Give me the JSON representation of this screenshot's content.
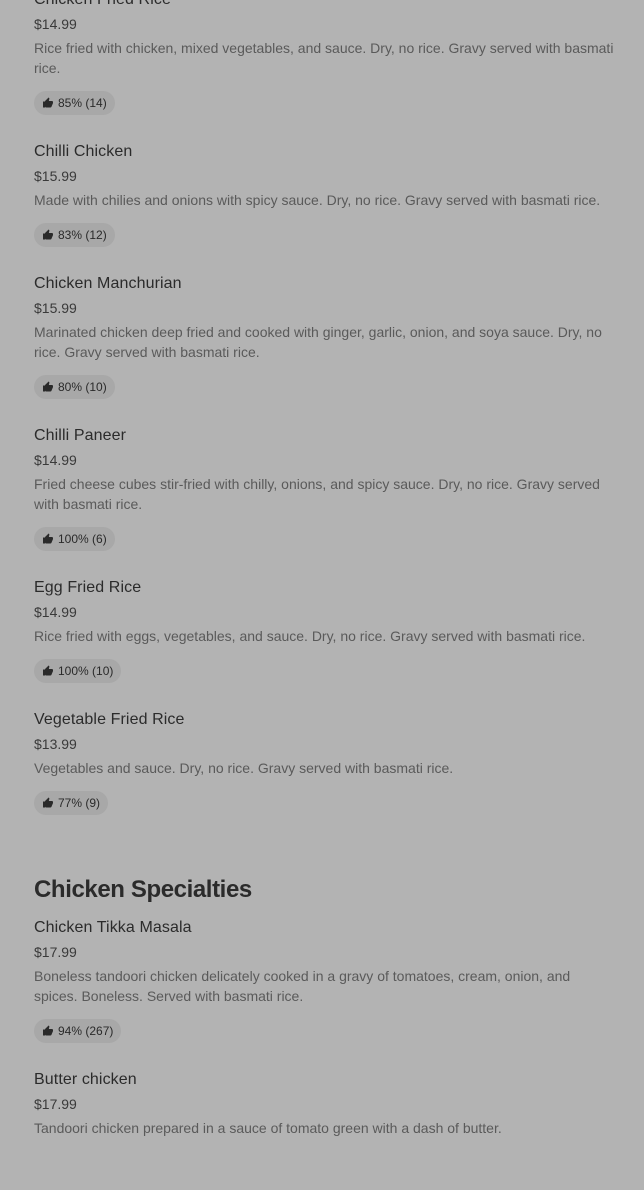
{
  "section1": {
    "items": [
      {
        "name": "Chicken Fried Rice",
        "price": "$14.99",
        "description": "Rice fried with chicken, mixed vegetables, and sauce. Dry, no rice. Gravy served with basmati rice.",
        "rating": "85% (14)"
      },
      {
        "name": "Chilli Chicken",
        "price": "$15.99",
        "description": "Made with chilies and onions with spicy sauce. Dry, no rice. Gravy served with basmati rice.",
        "rating": "83% (12)"
      },
      {
        "name": "Chicken Manchurian",
        "price": "$15.99",
        "description": "Marinated chicken deep fried and cooked with ginger, garlic, onion, and soya sauce. Dry, no rice. Gravy served with basmati rice.",
        "rating": "80% (10)"
      },
      {
        "name": "Chilli Paneer",
        "price": "$14.99",
        "description": "Fried cheese cubes stir-fried with chilly, onions, and spicy sauce. Dry, no rice. Gravy served with basmati rice.",
        "rating": "100% (6)"
      },
      {
        "name": "Egg Fried Rice",
        "price": "$14.99",
        "description": "Rice fried with eggs, vegetables, and sauce. Dry, no rice. Gravy served with basmati rice.",
        "rating": "100% (10)"
      },
      {
        "name": "Vegetable Fried Rice",
        "price": "$13.99",
        "description": "Vegetables and sauce. Dry, no rice. Gravy served with basmati rice.",
        "rating": "77% (9)"
      }
    ]
  },
  "section2": {
    "title": "Chicken Specialties",
    "items": [
      {
        "name": "Chicken Tikka Masala",
        "price": "$17.99",
        "description": "Boneless tandoori chicken delicately cooked in a gravy of tomatoes, cream, onion, and spices. Boneless. Served with basmati rice.",
        "rating": "94% (267)"
      },
      {
        "name": "Butter chicken",
        "price": "$17.99",
        "description": "Tandoori chicken prepared in a sauce of tomato green with a dash of butter."
      }
    ]
  },
  "icons": {
    "rating": "thumbs-up-icon"
  },
  "colors": {
    "background": "#b3b3b3",
    "badge": "#a8a8a8",
    "text": "#2a2a2a",
    "muted": "#5a5a5a"
  }
}
